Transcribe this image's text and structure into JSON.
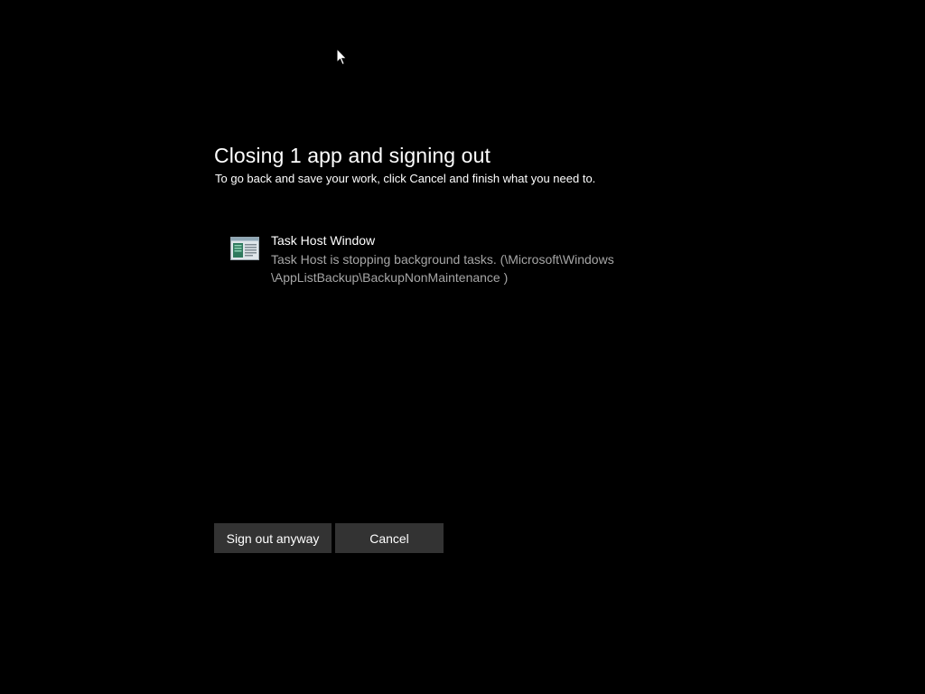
{
  "dialog": {
    "title": "Closing 1 app and signing out",
    "subtitle": "To go back and save your work, click Cancel and finish what you need to."
  },
  "apps": [
    {
      "name": "Task Host Window",
      "description_line1": "Task Host is stopping background tasks. (\\Microsoft\\Windows",
      "description_line2": "\\AppListBackup\\BackupNonMaintenance )",
      "icon": "task-host-window-icon"
    }
  ],
  "buttons": {
    "sign_out": "Sign out anyway",
    "cancel": "Cancel"
  },
  "colors": {
    "background": "#000000",
    "text_primary": "#ffffff",
    "text_secondary": "#a6a6a6",
    "button_bg": "#333333"
  }
}
